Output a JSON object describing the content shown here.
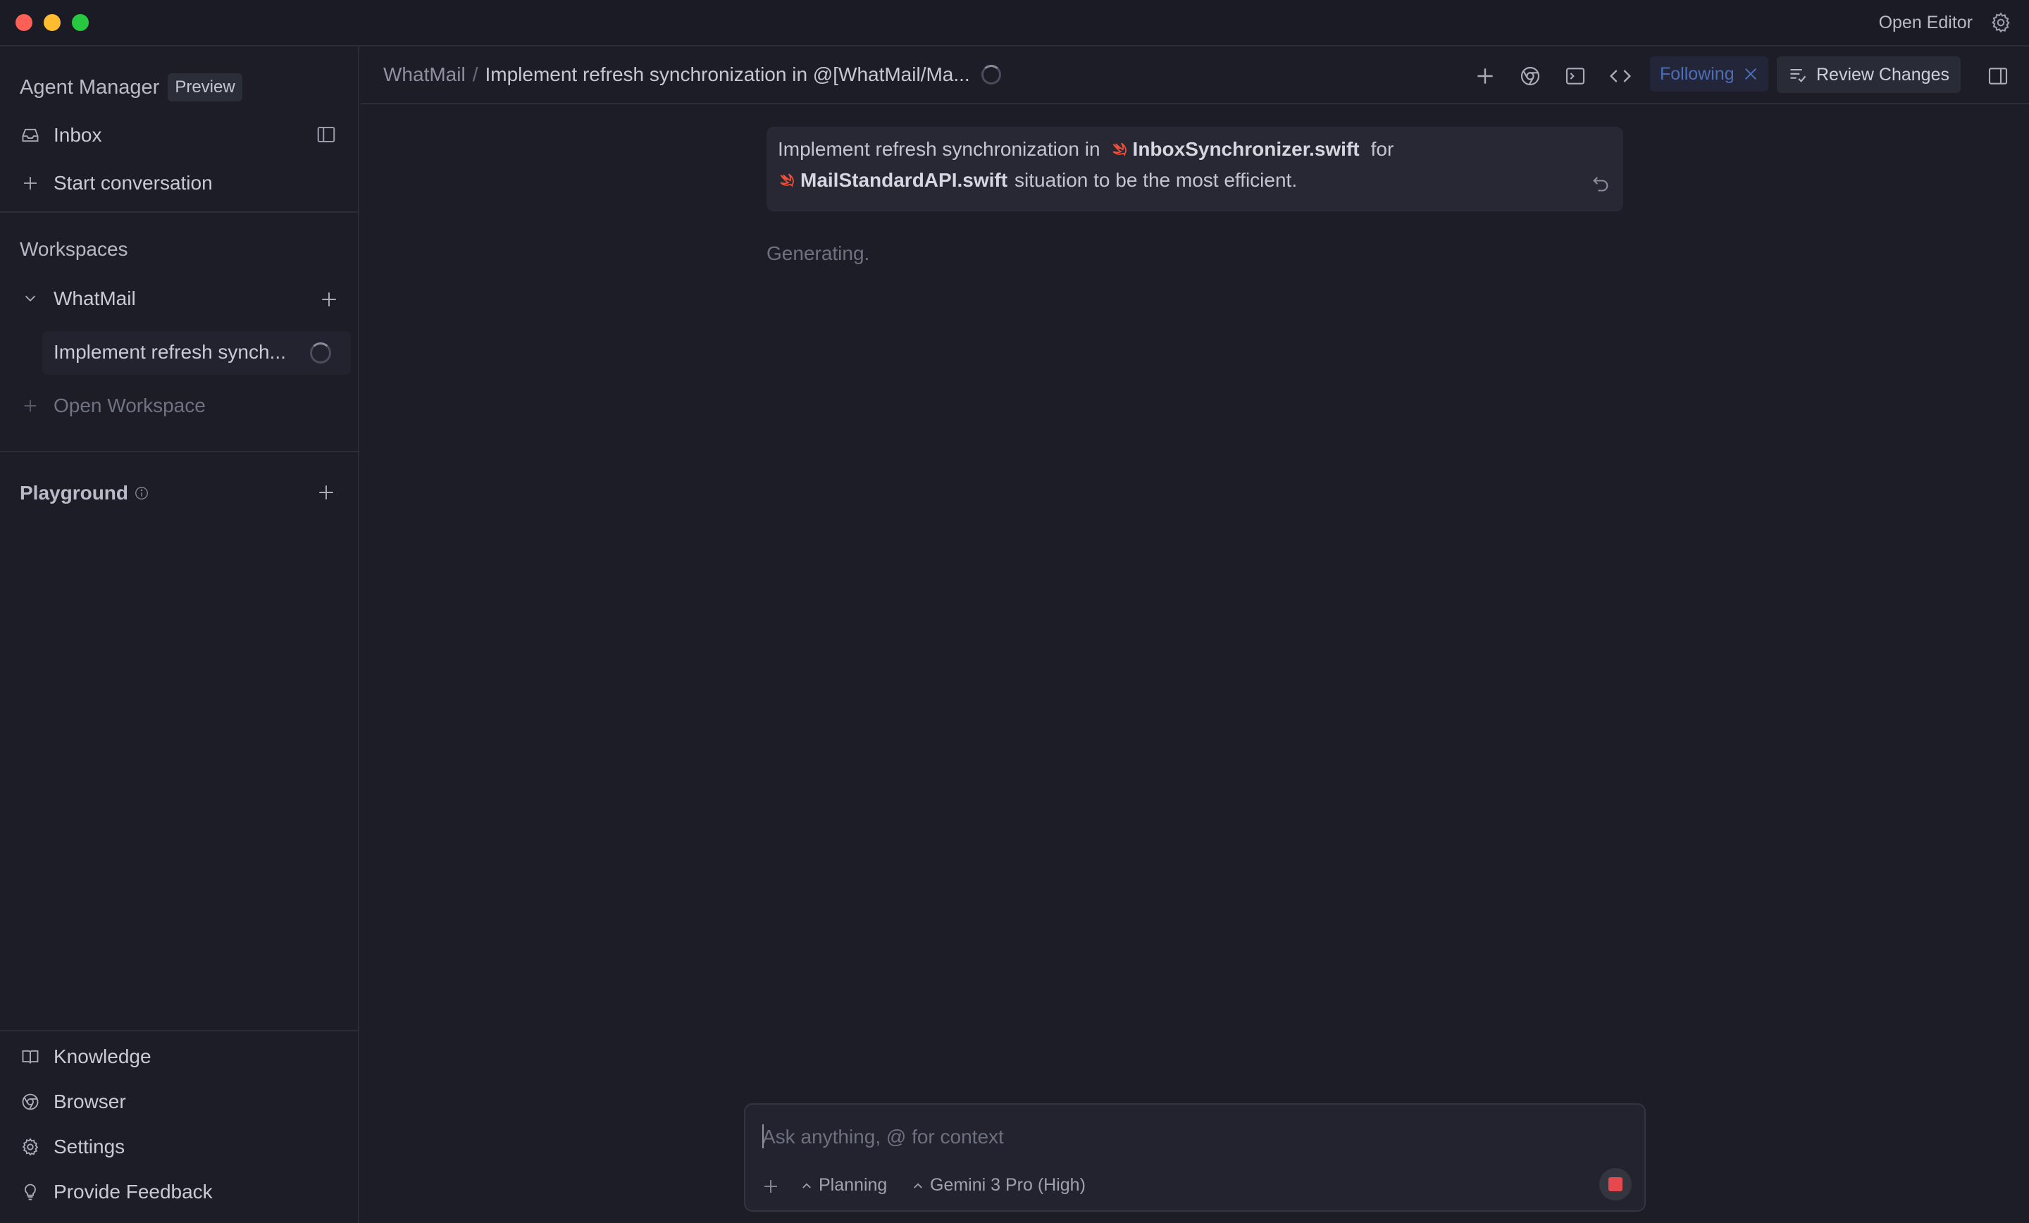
{
  "window": {
    "open_editor_label": "Open Editor"
  },
  "sidebar": {
    "title": "Agent Manager",
    "badge": "Preview",
    "inbox_label": "Inbox",
    "start_conversation_label": "Start conversation",
    "workspaces_label": "Workspaces",
    "workspace_name": "WhatMail",
    "workspace_item_label": "Implement refresh synch...",
    "open_workspace_label": "Open Workspace",
    "playground_label": "Playground",
    "bottom_items": [
      {
        "label": "Knowledge",
        "icon": "book-icon"
      },
      {
        "label": "Browser",
        "icon": "chrome-icon"
      },
      {
        "label": "Settings",
        "icon": "gear-icon"
      },
      {
        "label": "Provide Feedback",
        "icon": "lightbulb-icon"
      }
    ]
  },
  "header": {
    "breadcrumb_workspace": "WhatMail",
    "breadcrumb_separator": "/",
    "breadcrumb_title": "Implement refresh synchronization in @[WhatMail/Ma...",
    "following_label": "Following",
    "review_changes_label": "Review Changes"
  },
  "conversation": {
    "user_message": {
      "part1": "Implement refresh synchronization in",
      "file1": "InboxSynchronizer.swift",
      "part2": "for",
      "file2": "MailStandardAPI.swift",
      "part3": "situation to be the most efficient."
    },
    "status_text": "Generating."
  },
  "composer": {
    "placeholder": "Ask anything, @ for context",
    "mode_label": "Planning",
    "model_label": "Gemini 3 Pro (High)"
  },
  "colors": {
    "background": "#1c1d27",
    "accent_following": "#4d6db5",
    "swift_orange": "#f05138",
    "stop_red": "#e5484d"
  }
}
